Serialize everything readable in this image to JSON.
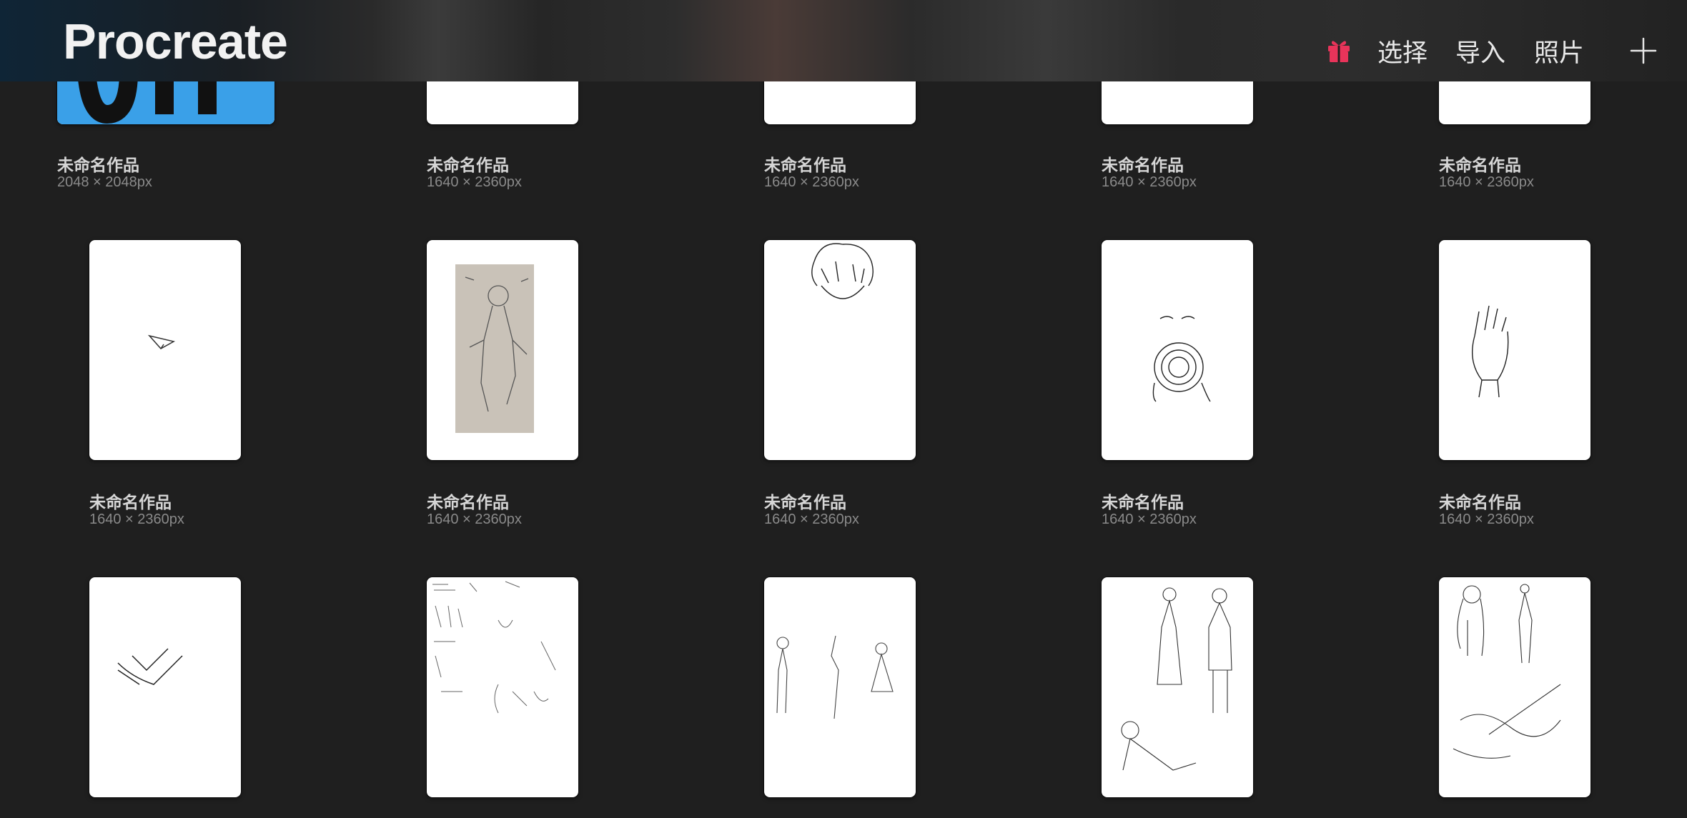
{
  "app": {
    "title": "Procreate"
  },
  "header": {
    "select_label": "选择",
    "import_label": "导入",
    "photos_label": "照片",
    "gift_icon": "gift-icon",
    "add_icon": "plus-icon",
    "gift_color": "#e8345a"
  },
  "gallery": {
    "artworks": [
      {
        "name": "未命名作品",
        "size": "2048 × 2048px"
      },
      {
        "name": "未命名作品",
        "size": "1640 × 2360px"
      },
      {
        "name": "未命名作品",
        "size": "1640 × 2360px"
      },
      {
        "name": "未命名作品",
        "size": "1640 × 2360px"
      },
      {
        "name": "未命名作品",
        "size": "1640 × 2360px"
      },
      {
        "name": "未命名作品",
        "size": "1640 × 2360px"
      },
      {
        "name": "未命名作品",
        "size": "1640 × 2360px"
      },
      {
        "name": "未命名作品",
        "size": "1640 × 2360px"
      },
      {
        "name": "未命名作品",
        "size": "1640 × 2360px"
      },
      {
        "name": "未命名作品",
        "size": "1640 × 2360px"
      },
      {},
      {},
      {},
      {},
      {}
    ]
  }
}
